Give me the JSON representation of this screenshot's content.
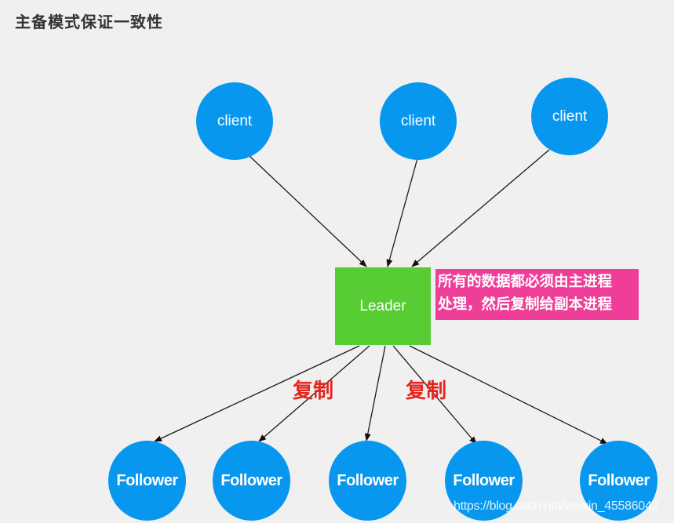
{
  "title": "主备模式保证一致性",
  "clients": [
    {
      "label": "client"
    },
    {
      "label": "client"
    },
    {
      "label": "client"
    }
  ],
  "leader": {
    "label": "Leader"
  },
  "note": {
    "lines": [
      "所有的数据都必须由主进程",
      "处理，然后复制给副本进程"
    ]
  },
  "copy_labels": [
    "复制",
    "复制"
  ],
  "followers": [
    {
      "label": "Follower"
    },
    {
      "label": "Follower"
    },
    {
      "label": "Follower"
    },
    {
      "label": "Follower"
    },
    {
      "label": "Follower"
    }
  ],
  "edges": [
    {
      "from": "client-1",
      "to": "leader"
    },
    {
      "from": "client-2",
      "to": "leader"
    },
    {
      "from": "client-3",
      "to": "leader"
    },
    {
      "from": "leader",
      "to": "follower-1"
    },
    {
      "from": "leader",
      "to": "follower-2"
    },
    {
      "from": "leader",
      "to": "follower-3"
    },
    {
      "from": "leader",
      "to": "follower-4"
    },
    {
      "from": "leader",
      "to": "follower-5"
    }
  ],
  "colors": {
    "node": "#0797ef",
    "leader": "#57cc33",
    "note": "#ef3e98",
    "copy_text": "#e5261e"
  },
  "watermark": "https://blog.csdn.net/weixin_45586042"
}
